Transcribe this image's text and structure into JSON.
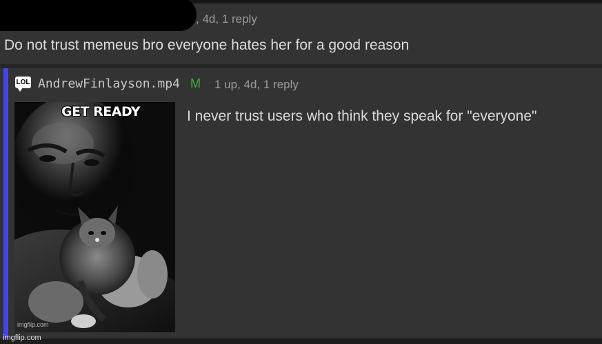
{
  "comment": {
    "meta": ", 4d, 1 reply",
    "text": "Do not trust memeus bro everyone hates her for a good reason"
  },
  "reply": {
    "flair_icon_text": "LOL",
    "username": "AndrewFinlayson.mp4",
    "mod_badge": "M",
    "meta": "1 up, 4d, 1 reply",
    "text": "I never trust users who think they speak for \"everyone\"",
    "meme": {
      "caption": "GET READY",
      "watermark": "imgflip.com"
    },
    "accent_color": "#4646e6"
  },
  "page_watermark": "imgflip.com"
}
